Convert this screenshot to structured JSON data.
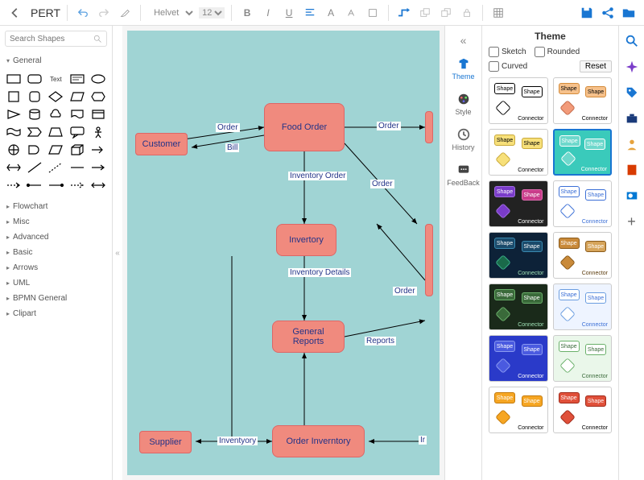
{
  "header": {
    "title": "PERT",
    "font": "Helvetica",
    "size": "12"
  },
  "sidebar": {
    "search_placeholder": "Search Shapes",
    "open_category": "General",
    "categories": [
      "Flowchart",
      "Misc",
      "Advanced",
      "Basic",
      "Arrows",
      "UML",
      "BPMN General",
      "Clipart"
    ]
  },
  "canvas": {
    "nodes": {
      "customer": "Customer",
      "food_order": "Food Order",
      "inventory": "Invertory",
      "general_reports": "General Reports",
      "order_inventory": "Order Inverntory",
      "supplier": "Supplier"
    },
    "edges": {
      "order1": "Order",
      "order2": "Order",
      "bill": "Bill",
      "inv_order": "Inventory Order",
      "order3": "Order",
      "inv_details": "Inventory Details",
      "order4": "Order",
      "reports": "Reports",
      "inventyory": "Inventyory",
      "ir": "Ir"
    }
  },
  "rail": {
    "theme": "Theme",
    "style": "Style",
    "history": "History",
    "feedback": "FeedBack"
  },
  "theme": {
    "title": "Theme",
    "sketch": "Sketch",
    "rounded": "Rounded",
    "curved": "Curved",
    "reset": "Reset",
    "card_shape": "Shape",
    "card_connector": "Connector",
    "cards": [
      {
        "bg": "#ffffff",
        "s1": "#ffffff",
        "s1b": "#000",
        "s2": "#ffffff",
        "s2b": "#000",
        "dia": "#ffffff",
        "diab": "#000",
        "txt": "#000",
        "conn": "#000"
      },
      {
        "bg": "#ffffff",
        "s1": "#f6c18b",
        "s1b": "#d48b3a",
        "s2": "#f6c18b",
        "s2b": "#d48b3a",
        "dia": "#f29b7a",
        "diab": "#c46a4a",
        "txt": "#000",
        "conn": "#000"
      },
      {
        "bg": "#ffffff",
        "s1": "#f7e07a",
        "s1b": "#c9a93a",
        "s2": "#f7e07a",
        "s2b": "#c9a93a",
        "dia": "#f7e07a",
        "diab": "#c9a93a",
        "txt": "#000",
        "conn": "#000"
      },
      {
        "bg": "#3acabb",
        "s1": "#6ed8cc",
        "s1b": "#fff",
        "s2": "#6ed8cc",
        "s2b": "#fff",
        "dia": "#6ed8cc",
        "diab": "#fff",
        "txt": "#fff",
        "conn": "#fff",
        "sel": true
      },
      {
        "bg": "#222222",
        "s1": "#7a3cc9",
        "s1b": "#a06be0",
        "s2": "#c93c8a",
        "s2b": "#e06bb0",
        "dia": "#7a3cc9",
        "diab": "#a06be0",
        "txt": "#fff",
        "conn": "#fff"
      },
      {
        "bg": "#ffffff",
        "s1": "#ffffff",
        "s1b": "#3b6fd6",
        "s2": "#ffffff",
        "s2b": "#3b6fd6",
        "dia": "#ffffff",
        "diab": "#3b6fd6",
        "txt": "#3b6fd6",
        "conn": "#3b6fd6"
      },
      {
        "bg": "#0d2238",
        "s1": "#1a4a6a",
        "s1b": "#3a8ab0",
        "s2": "#1a4a6a",
        "s2b": "#3a8ab0",
        "dia": "#1a6a4a",
        "diab": "#3ab08a",
        "txt": "#fff",
        "conn": "#9fe0b5"
      },
      {
        "bg": "#ffffff",
        "s1": "#c98a3a",
        "s1b": "#8a5a1a",
        "s2": "#d6a45a",
        "s2b": "#8a5a1a",
        "dia": "#c98a3a",
        "diab": "#8a5a1a",
        "txt": "#fff",
        "conn": "#5a3a0a"
      },
      {
        "bg": "#1a2a1a",
        "s1": "#3a6a3a",
        "s1b": "#6ab06a",
        "s2": "#3a6a3a",
        "s2b": "#6ab06a",
        "dia": "#3a6a3a",
        "diab": "#6ab06a",
        "txt": "#fff",
        "conn": "#9fe0b5"
      },
      {
        "bg": "#eef4ff",
        "s1": "#ffffff",
        "s1b": "#6a9de0",
        "s2": "#ffffff",
        "s2b": "#6a9de0",
        "dia": "#ffffff",
        "diab": "#6a9de0",
        "txt": "#3b6fd6",
        "conn": "#3b6fd6"
      },
      {
        "bg": "#2a3ac9",
        "s1": "#4a5ae0",
        "s1b": "#8a9af0",
        "s2": "#4a5ae0",
        "s2b": "#8a9af0",
        "dia": "#4a5ae0",
        "diab": "#8a9af0",
        "txt": "#fff",
        "conn": "#fff"
      },
      {
        "bg": "#eaf7ea",
        "s1": "#ffffff",
        "s1b": "#6ab06a",
        "s2": "#ffffff",
        "s2b": "#6ab06a",
        "dia": "#ffffff",
        "diab": "#6ab06a",
        "txt": "#3a6a3a",
        "conn": "#3a6a3a"
      },
      {
        "bg": "#ffffff",
        "s1": "#f6a623",
        "s1b": "#c47a0a",
        "s2": "#f6a623",
        "s2b": "#c47a0a",
        "dia": "#f6a623",
        "diab": "#c47a0a",
        "txt": "#fff",
        "conn": "#000"
      },
      {
        "bg": "#ffffff",
        "s1": "#e0503a",
        "s1b": "#a02a1a",
        "s2": "#e0503a",
        "s2b": "#a02a1a",
        "dia": "#e0503a",
        "diab": "#a02a1a",
        "txt": "#fff",
        "conn": "#000"
      }
    ]
  }
}
